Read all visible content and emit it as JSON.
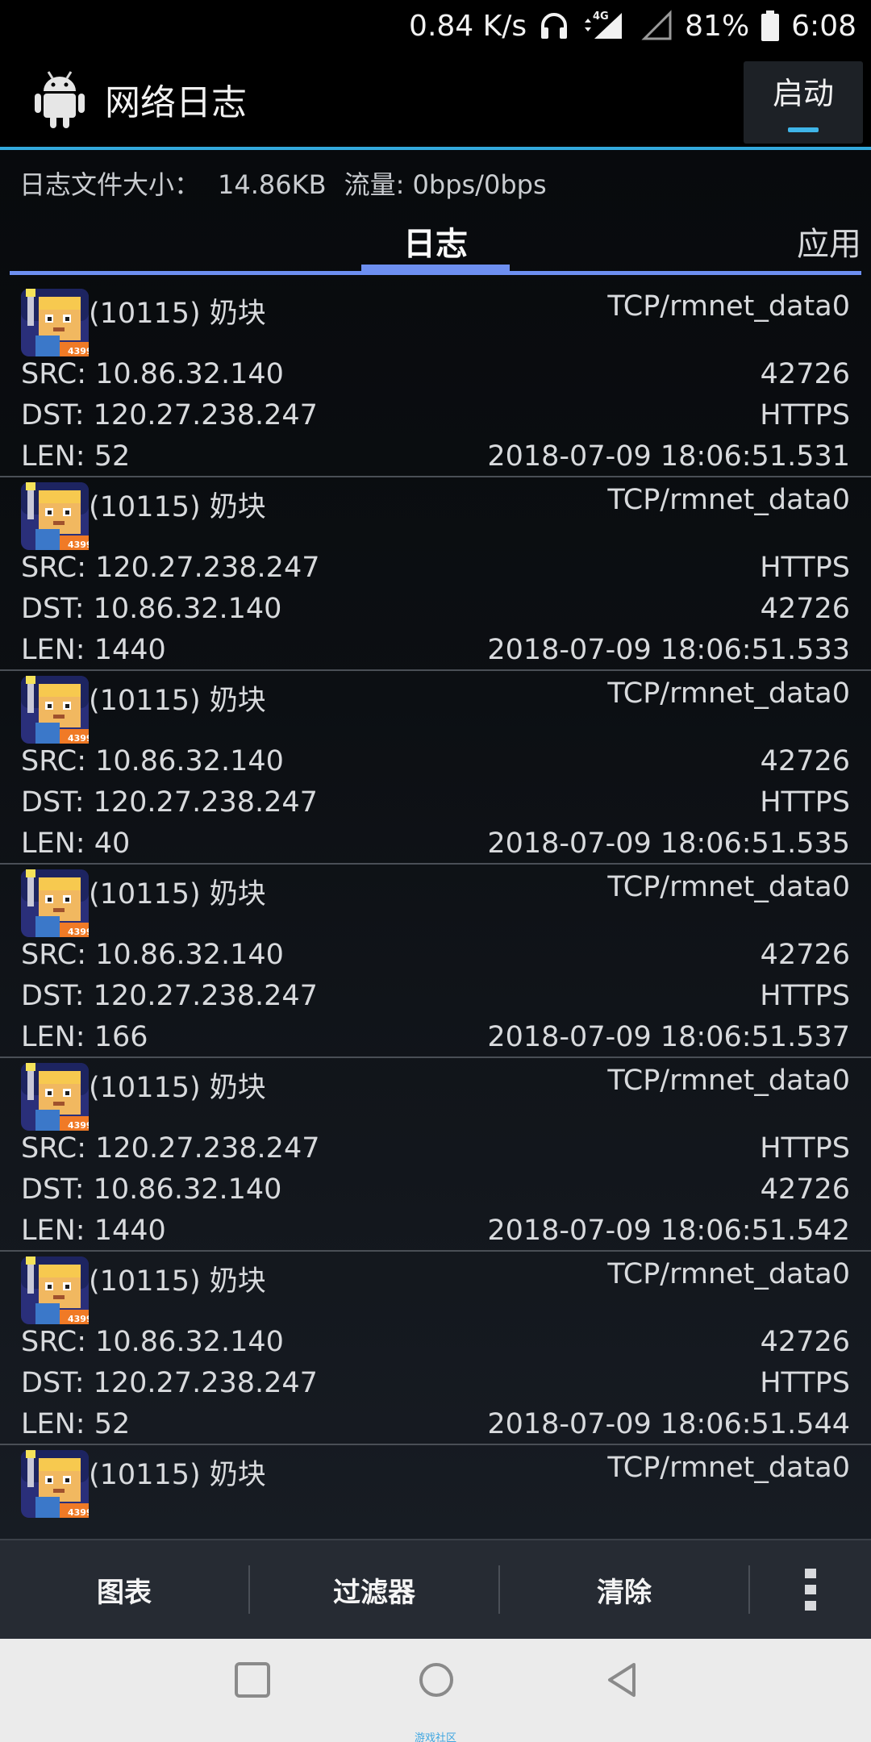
{
  "status_bar": {
    "speed": "0.84 K/s",
    "network": "4G",
    "battery": "81%",
    "time": "6:08"
  },
  "app_bar": {
    "title": "网络日志",
    "start_button": "启动"
  },
  "info": {
    "file_size_label": "日志文件大小：",
    "file_size": "14.86KB",
    "traffic": "流量: 0bps/0bps"
  },
  "tabs": [
    "日志",
    "应用"
  ],
  "entries": [
    {
      "app": "(10115) 奶块",
      "proto": "TCP/rmnet_data0",
      "src": "SRC: 10.86.32.140",
      "src_port": "42726",
      "dst": "DST: 120.27.238.247",
      "dst_port": "HTTPS",
      "len": "LEN: 52",
      "time": "2018-07-09 18:06:51.531"
    },
    {
      "app": "(10115) 奶块",
      "proto": "TCP/rmnet_data0",
      "src": "SRC: 120.27.238.247",
      "src_port": "HTTPS",
      "dst": "DST: 10.86.32.140",
      "dst_port": "42726",
      "len": "LEN: 1440",
      "time": "2018-07-09 18:06:51.533"
    },
    {
      "app": "(10115) 奶块",
      "proto": "TCP/rmnet_data0",
      "src": "SRC: 10.86.32.140",
      "src_port": "42726",
      "dst": "DST: 120.27.238.247",
      "dst_port": "HTTPS",
      "len": "LEN: 40",
      "time": "2018-07-09 18:06:51.535"
    },
    {
      "app": "(10115) 奶块",
      "proto": "TCP/rmnet_data0",
      "src": "SRC: 10.86.32.140",
      "src_port": "42726",
      "dst": "DST: 120.27.238.247",
      "dst_port": "HTTPS",
      "len": "LEN: 166",
      "time": "2018-07-09 18:06:51.537"
    },
    {
      "app": "(10115) 奶块",
      "proto": "TCP/rmnet_data0",
      "src": "SRC: 120.27.238.247",
      "src_port": "HTTPS",
      "dst": "DST: 10.86.32.140",
      "dst_port": "42726",
      "len": "LEN: 1440",
      "time": "2018-07-09 18:06:51.542"
    },
    {
      "app": "(10115) 奶块",
      "proto": "TCP/rmnet_data0",
      "src": "SRC: 10.86.32.140",
      "src_port": "42726",
      "dst": "DST: 120.27.238.247",
      "dst_port": "HTTPS",
      "len": "LEN: 52",
      "time": "2018-07-09 18:06:51.544"
    },
    {
      "app": "(10115) 奶块",
      "proto": "TCP/rmnet_data0"
    }
  ],
  "toolbar": {
    "chart": "图表",
    "filter": "过滤器",
    "clear": "清除"
  },
  "watermark": "游戏社区",
  "colors": {
    "accent": "#33a9dc",
    "tab_indicator": "#6d8ff0"
  }
}
